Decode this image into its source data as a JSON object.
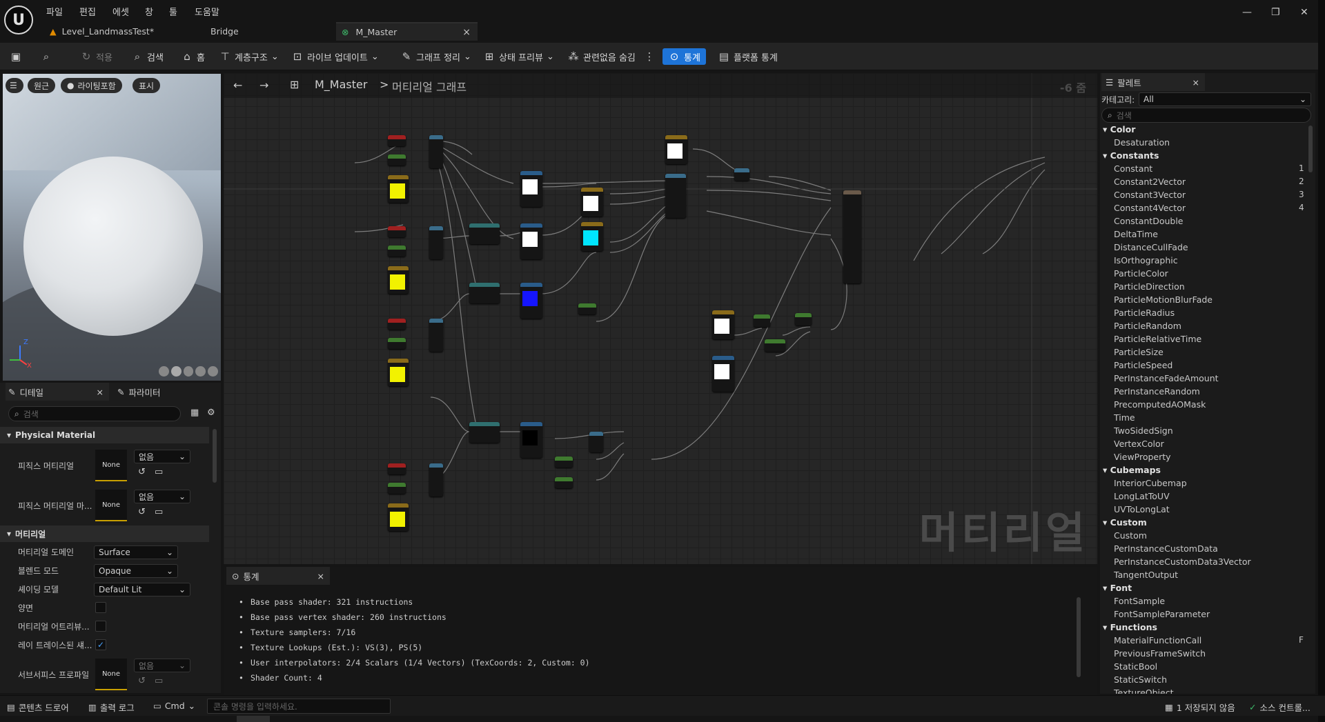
{
  "menubar": {
    "logo": "U",
    "items": [
      "파일",
      "편집",
      "에셋",
      "창",
      "툴",
      "도움말"
    ]
  },
  "window_controls": {
    "minimize": "—",
    "restore": "❐",
    "close": "✕"
  },
  "tabs": [
    {
      "label": "Level_LandmassTest*"
    },
    {
      "label": "Bridge"
    },
    {
      "label": "M_Master",
      "close": "×"
    }
  ],
  "toolbar": {
    "apply": "적용",
    "search": "검색",
    "home": "홈",
    "hierarchy": "계층구조",
    "live_update": "라이브 업데이트",
    "graph_cleanup": "그래프 정리",
    "state_preview": "상태 프리뷰",
    "hide_unrelated": "관련없음 숨김",
    "stats": "통계",
    "platform_stats": "플랫폼 통계"
  },
  "viewport": {
    "chip_perspective": "원근",
    "chip_lighting": "라이팅포함",
    "chip_show": "표시"
  },
  "details": {
    "tab_details": "디테일",
    "tab_params": "파라미터",
    "search_placeholder": "검색",
    "sect_physical": "Physical Material",
    "phys_material_label": "피직스 머티리얼",
    "phys_material_mask_label": "피직스 머티리얼 마...",
    "none": "None",
    "combo_none": "없음",
    "sect_material": "머티리얼",
    "domain_label": "머티리얼 도메인",
    "domain_value": "Surface",
    "blend_label": "블렌드 모드",
    "blend_value": "Opaque",
    "shading_label": "셰이딩 모델",
    "shading_value": "Default Lit",
    "twosided_label": "양면",
    "attrs_label": "머티리얼 어트리뷰...",
    "raytraced_label": "레이 트레이스된 섀...",
    "subsurface_label": "서브서피스 프로파일"
  },
  "graph": {
    "breadcrumb_root": "M_Master",
    "breadcrumb_sep": ">",
    "breadcrumb_current": "머티리얼 그래프",
    "zoom": "-6 줌",
    "watermark": "머티리얼"
  },
  "stats": {
    "tab_label": "통계",
    "lines": [
      "Base pass shader: 321 instructions",
      "Base pass vertex shader: 260 instructions",
      "Texture samplers: 7/16",
      "Texture Lookups (Est.): VS(3), PS(5)",
      "User interpolators: 2/4 Scalars (1/4 Vectors) (TexCoords: 2, Custom: 0)",
      "Shader Count: 4"
    ]
  },
  "palette": {
    "tab_label": "팔레트",
    "category_label": "카테고리:",
    "category_value": "All",
    "search_placeholder": "검색",
    "rows": [
      {
        "type": "cat",
        "label": "Color"
      },
      {
        "type": "item",
        "label": "Desaturation"
      },
      {
        "type": "cat",
        "label": "Constants"
      },
      {
        "type": "item",
        "label": "Constant",
        "key": "1"
      },
      {
        "type": "item",
        "label": "Constant2Vector",
        "key": "2"
      },
      {
        "type": "item",
        "label": "Constant3Vector",
        "key": "3"
      },
      {
        "type": "item",
        "label": "Constant4Vector",
        "key": "4"
      },
      {
        "type": "item",
        "label": "ConstantDouble"
      },
      {
        "type": "item",
        "label": "DeltaTime"
      },
      {
        "type": "item",
        "label": "DistanceCullFade"
      },
      {
        "type": "item",
        "label": "IsOrthographic"
      },
      {
        "type": "item",
        "label": "ParticleColor"
      },
      {
        "type": "item",
        "label": "ParticleDirection"
      },
      {
        "type": "item",
        "label": "ParticleMotionBlurFade"
      },
      {
        "type": "item",
        "label": "ParticleRadius"
      },
      {
        "type": "item",
        "label": "ParticleRandom"
      },
      {
        "type": "item",
        "label": "ParticleRelativeTime"
      },
      {
        "type": "item",
        "label": "ParticleSize"
      },
      {
        "type": "item",
        "label": "ParticleSpeed"
      },
      {
        "type": "item",
        "label": "PerInstanceFadeAmount"
      },
      {
        "type": "item",
        "label": "PerInstanceRandom"
      },
      {
        "type": "item",
        "label": "PrecomputedAOMask"
      },
      {
        "type": "item",
        "label": "Time"
      },
      {
        "type": "item",
        "label": "TwoSidedSign"
      },
      {
        "type": "item",
        "label": "VertexColor"
      },
      {
        "type": "item",
        "label": "ViewProperty"
      },
      {
        "type": "cat",
        "label": "Cubemaps"
      },
      {
        "type": "item",
        "label": "InteriorCubemap"
      },
      {
        "type": "item",
        "label": "LongLatToUV"
      },
      {
        "type": "item",
        "label": "UVToLongLat"
      },
      {
        "type": "cat",
        "label": "Custom"
      },
      {
        "type": "item",
        "label": "Custom"
      },
      {
        "type": "item",
        "label": "PerInstanceCustomData"
      },
      {
        "type": "item",
        "label": "PerInstanceCustomData3Vector"
      },
      {
        "type": "item",
        "label": "TangentOutput"
      },
      {
        "type": "cat",
        "label": "Font"
      },
      {
        "type": "item",
        "label": "FontSample"
      },
      {
        "type": "item",
        "label": "FontSampleParameter"
      },
      {
        "type": "cat",
        "label": "Functions"
      },
      {
        "type": "item",
        "label": "MaterialFunctionCall",
        "key": "F"
      },
      {
        "type": "item",
        "label": "PreviousFrameSwitch"
      },
      {
        "type": "item",
        "label": "StaticBool"
      },
      {
        "type": "item",
        "label": "StaticSwitch"
      },
      {
        "type": "item",
        "label": "TextureObject"
      }
    ]
  },
  "statusbar": {
    "content_drawer": "콘텐츠 드로어",
    "output_log": "출력 로그",
    "cmd": "Cmd",
    "console_placeholder": "콘솔 명령을 입력하세요.",
    "unsaved": "1 저장되지 않음",
    "source_control": "소스 컨트롤..."
  },
  "colors": {
    "accent": "#1e74d8",
    "yellow": "#f2f200",
    "cyan": "#00e5ff",
    "blue": "#1515ff",
    "white": "#ffffff"
  }
}
